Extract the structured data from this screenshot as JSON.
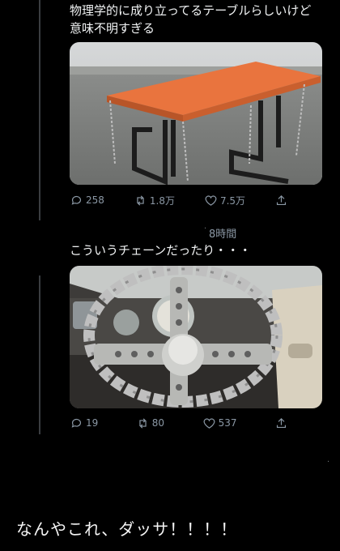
{
  "tweet1": {
    "text": "物理学的に成り立ってるテーブルらしいけど意味不明すぎる",
    "reply_count": "258",
    "retweet_count": "1.8万",
    "like_count": "7.5万"
  },
  "tweet2": {
    "time": "8時間",
    "text": "こういうチェーンだったり・・・",
    "reply_count": "19",
    "retweet_count": "80",
    "like_count": "537"
  },
  "caption": "なんやこれ、ダッサ！！！！",
  "colors": {
    "background": "#000000",
    "muted": "#8b98a5",
    "thread_line": "#3a3d41",
    "table_top": "#e9743e"
  }
}
